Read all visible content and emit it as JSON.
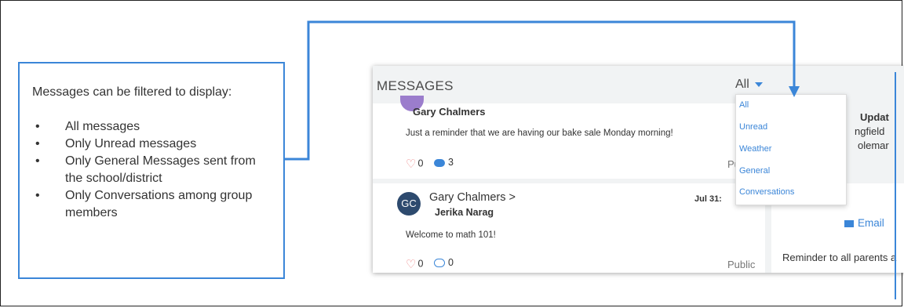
{
  "callout": {
    "title": "Messages can be filtered to display:",
    "items": [
      "All messages",
      "Only Unread messages",
      "Only General Messages sent from the school/district",
      "Only Conversations among group members"
    ]
  },
  "app": {
    "title": "MESSAGES",
    "filter_selected": "All",
    "filter_options": [
      "All",
      "Unread",
      "Weather",
      "General",
      "Conversations"
    ],
    "messages": [
      {
        "sender": "Gary Chalmers",
        "text": "Just a reminder that we are having our bake sale Monday morning!",
        "likes": "0",
        "comments": "3",
        "visibility": "Publ"
      },
      {
        "avatar_initials": "GC",
        "sender": "Gary Chalmers >",
        "recipient": "Jerika Narag",
        "date": "Jul 31:",
        "text": "Welcome to math 101!",
        "likes": "0",
        "comments": "0",
        "visibility": "Public"
      }
    ],
    "side_panel": {
      "line1": "Updat",
      "line2": "ngfield",
      "line3": "olemar",
      "email_label": "Email",
      "reminder": "Reminder to all parents a"
    }
  },
  "colors": {
    "accent": "#3b86d8",
    "panel_bg": "#f1f3f4",
    "avatar_gc": "#2d4a6e"
  }
}
